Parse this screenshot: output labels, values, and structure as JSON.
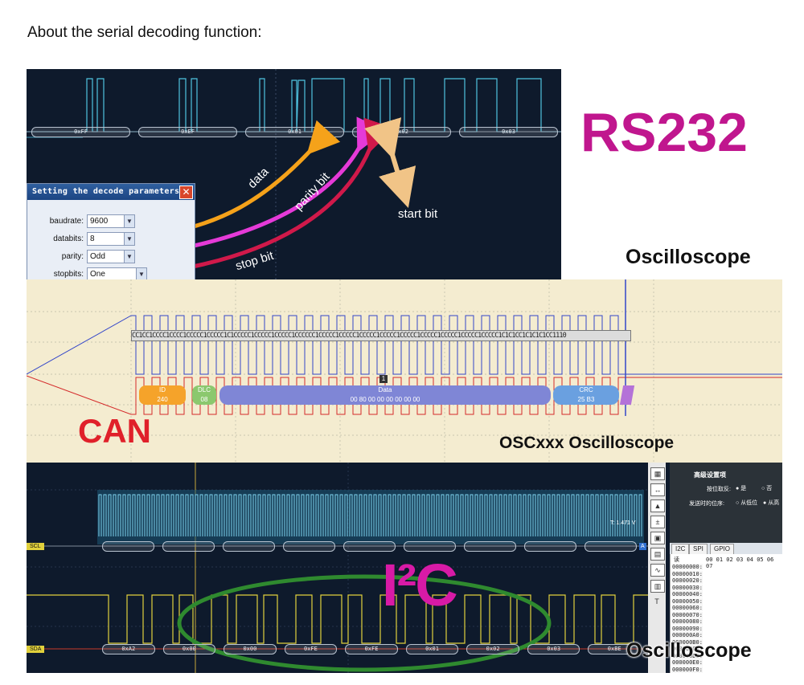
{
  "intro_text": "About the serial decoding function:",
  "rs232": {
    "heading": "RS232",
    "caption": "Oscilloscope",
    "bus_labels": [
      "0xFF",
      "0xEF",
      "0x01",
      "0x02",
      "0x03"
    ],
    "annotations": {
      "data": "data",
      "parity": "parity bit",
      "stop": "stop bit",
      "start": "start bit"
    },
    "dialog": {
      "title": "Setting the decode parameters",
      "close_glyph": "✕",
      "fields": [
        {
          "label": "baudrate:",
          "value": "9600"
        },
        {
          "label": "databits:",
          "value": "8"
        },
        {
          "label": "parity:",
          "value": "Odd"
        },
        {
          "label": "stopbits:",
          "value": "One"
        }
      ],
      "dropdown_glyph": "▼"
    },
    "colors": {
      "trace": "#4fc3e0",
      "data_arrow": "#f5a21a",
      "parity_arrow": "#e53ad8",
      "stop_arrow": "#d0194a",
      "start_arrow": "#f1c487",
      "heading": "#c0168e"
    }
  },
  "can": {
    "heading": "CAN",
    "caption": "OSCxxx Oscilloscope",
    "bit_string": "CC1CC1CCCC1CCCC1CCCCC1CCCCC1C1CCCCC1CCCCC1CCCCC1CCCCCC1CCCCC1CCCCC1CCCCC1CCCCC1CCCCC1CCCCC1CCCCC1CCCCC1CCCCC1C1C1CC1C1C1C1CC1110",
    "marker": "1",
    "fields": [
      {
        "name": "ID",
        "value": "240"
      },
      {
        "name": "DLC",
        "value": "08"
      },
      {
        "name": "Data",
        "value": "00 80 00 00 00 00 00 00"
      },
      {
        "name": "CRC",
        "value": "25 B3"
      }
    ],
    "colors": {
      "heading": "#e0202a",
      "trace_blue": "#3346c9",
      "trace_red": "#d42a2a",
      "id": "#f5a32a",
      "dlc": "#8bc86e",
      "data": "#7f86d6",
      "crc": "#6aa0e0",
      "end": "#b472d8"
    }
  },
  "i2c": {
    "heading": "I²C",
    "caption": "Oscilloscope",
    "scl_tag": "SCL",
    "sda_tag": "SDA",
    "level_readout": "T: 1.471 V",
    "channel_a": "A",
    "bus_labels": [
      "0xA2",
      "0x00",
      "0x00",
      "0xFE",
      "0xFE",
      "0x01",
      "0x02",
      "0x03",
      "0xBE"
    ],
    "config_panel": {
      "title": "高级设置项",
      "row1_label": "按位取反:",
      "row1_opt1": "是",
      "row1_opt2": "否",
      "row2_label": "发送时的位序:",
      "row2_opt1": "从低位",
      "row2_opt2": "从高"
    },
    "tabs": [
      "I2C",
      "SPI",
      "GPIO"
    ],
    "read_label": "读",
    "hex_header": "00 01 02 03 04 05 06 07",
    "hex_rows": [
      "00000000:",
      "00000010:",
      "00000020:",
      "00000030:",
      "00000040:",
      "00000050:",
      "00000060:",
      "00000070:",
      "00000080:",
      "00000090:",
      "000000A0:",
      "000000B0:",
      "000000C0:",
      "000000D0:",
      "000000E0:",
      "000000F0:"
    ],
    "colors": {
      "heading": "#d81aa6",
      "scl": "#2fa6c8",
      "sda": "#e1d13c",
      "ellipse": "#2f8a2f"
    }
  }
}
